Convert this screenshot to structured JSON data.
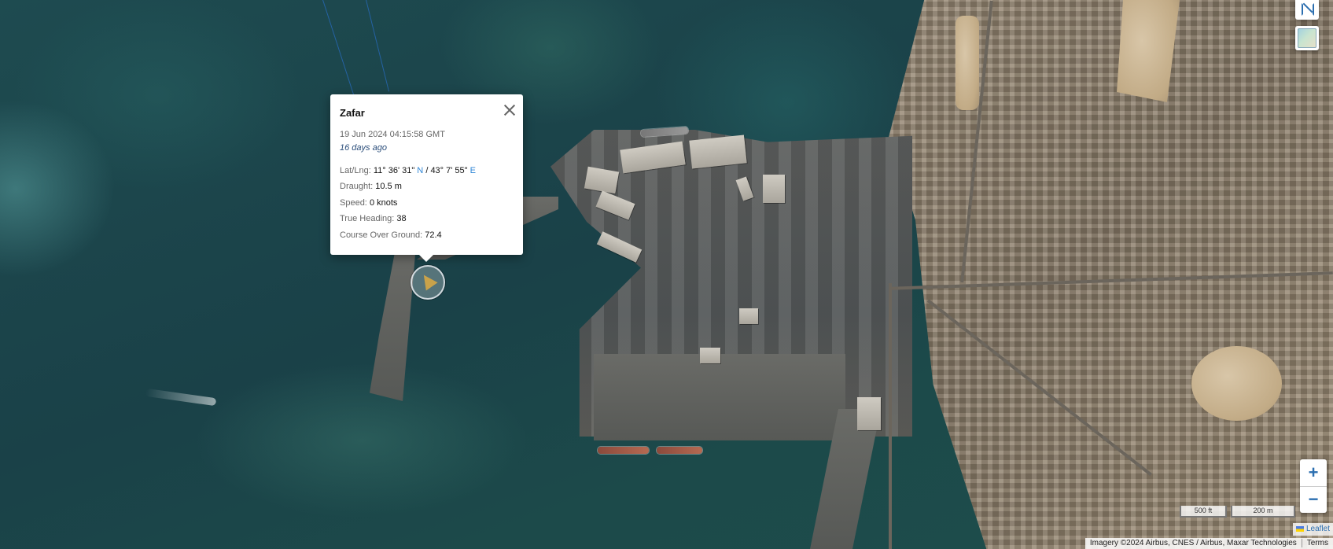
{
  "map": {
    "imagery_attribution": "Imagery ©2024 Airbus, CNES / Airbus, Maxar Technologies",
    "terms_link": "Terms",
    "leaflet_link": "Leaflet",
    "scale": {
      "imperial": "500 ft",
      "metric": "200 m"
    },
    "zoom_in_label": "+",
    "zoom_out_label": "−",
    "accent_color": "#2c6fb0"
  },
  "popup": {
    "vessel_name": "Zafar",
    "timestamp": "19 Jun 2024 04:15:58 GMT",
    "relative_time": "16 days ago",
    "latlng_label": "Lat/Lng:",
    "lat_value": "11° 36' 31\"",
    "lat_hemisphere": "N",
    "separator": "/",
    "lng_value": "43° 7' 55\"",
    "lng_hemisphere": "E",
    "draught_label": "Draught:",
    "draught_value": "10.5 m",
    "speed_label": "Speed:",
    "speed_value": "0 knots",
    "heading_label": "True Heading:",
    "heading_value": "38",
    "cog_label": "Course Over Ground:",
    "cog_value": "72.4"
  },
  "icons": {
    "fullscreen": "fullscreen-icon",
    "layers": "layers-icon",
    "close": "close-icon",
    "vessel": "vessel-icon"
  }
}
